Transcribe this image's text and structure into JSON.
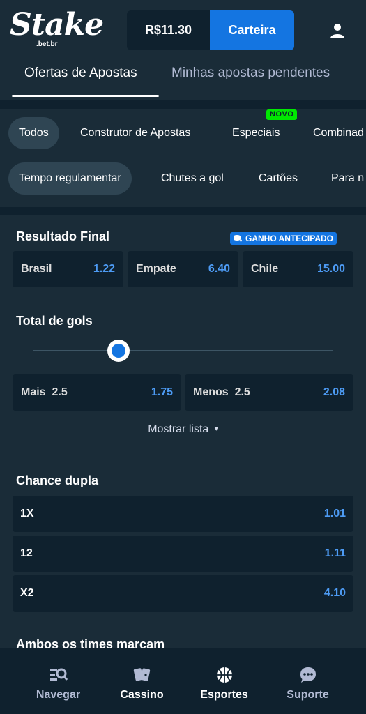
{
  "header": {
    "logo_text": "Stake",
    "logo_sub": ".bet.br",
    "balance": "R$11.30",
    "wallet_label": "Carteira",
    "user_icon": "user-icon"
  },
  "main_tabs": [
    {
      "label": "Ofertas de Apostas",
      "active": true
    },
    {
      "label": "Minhas apostas pendentes",
      "active": false
    }
  ],
  "filters_row1": [
    {
      "label": "Todos",
      "active": true
    },
    {
      "label": "Construtor de Apostas",
      "active": false
    },
    {
      "label": "Especiais",
      "active": false,
      "badge": "NOVO"
    },
    {
      "label": "Combinad",
      "active": false
    }
  ],
  "filters_row2": [
    {
      "label": "Tempo regulamentar",
      "active": true
    },
    {
      "label": "Chutes a gol",
      "active": false
    },
    {
      "label": "Cartões",
      "active": false
    },
    {
      "label": "Para n",
      "active": false
    }
  ],
  "resultado_final": {
    "title": "Resultado Final",
    "badge": "GANHO ANTECIPADO",
    "options": [
      {
        "label": "Brasil",
        "odd": "1.22"
      },
      {
        "label": "Empate",
        "odd": "6.40"
      },
      {
        "label": "Chile",
        "odd": "15.00"
      }
    ]
  },
  "total_gols": {
    "title": "Total de gols",
    "options": [
      {
        "label": "Mais",
        "line": "2.5",
        "odd": "1.75"
      },
      {
        "label": "Menos",
        "line": "2.5",
        "odd": "2.08"
      }
    ],
    "show_list": "Mostrar lista"
  },
  "chance_dupla": {
    "title": "Chance dupla",
    "options": [
      {
        "label": "1X",
        "odd": "1.01"
      },
      {
        "label": "12",
        "odd": "1.11"
      },
      {
        "label": "X2",
        "odd": "4.10"
      }
    ]
  },
  "ambos": {
    "title": "Ambos os times marcam"
  },
  "bottom_nav": [
    {
      "label": "Navegar",
      "icon": "browse-icon"
    },
    {
      "label": "Cassino",
      "icon": "cards-icon"
    },
    {
      "label": "Esportes",
      "icon": "basketball-icon"
    },
    {
      "label": "Suporte",
      "icon": "chat-icon"
    }
  ],
  "colors": {
    "background": "#0f212e",
    "panel": "#1a2c38",
    "accent_blue": "#1475e1",
    "odd_text": "#4d9bf4",
    "novo_green": "#00e701"
  }
}
